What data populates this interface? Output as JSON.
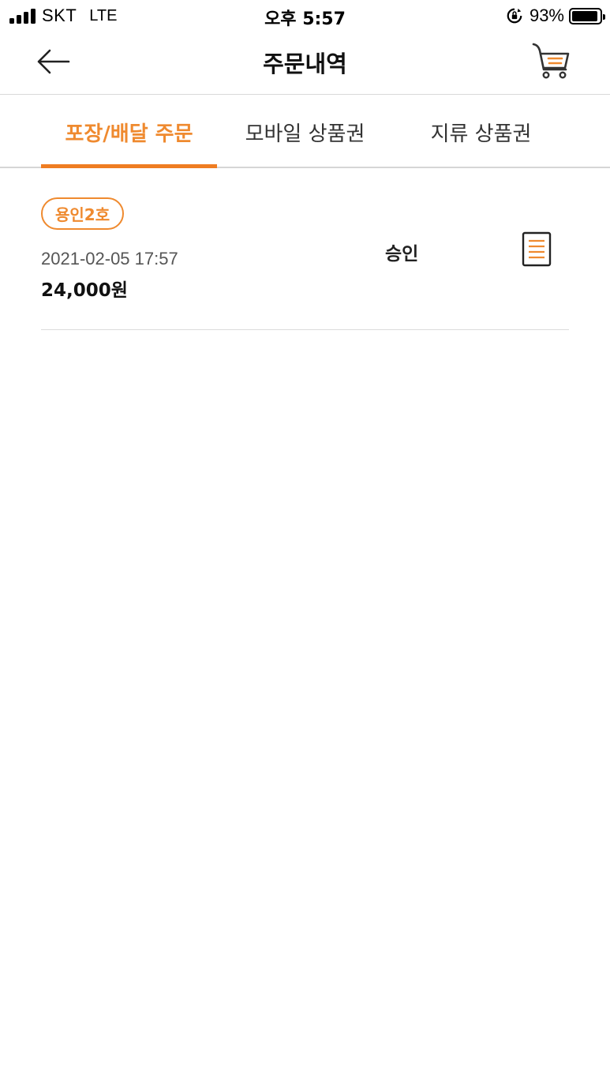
{
  "status_bar": {
    "carrier": "SKT",
    "network": "LTE",
    "time": "오후 5:57",
    "battery": "93%",
    "battery_level": 0.93
  },
  "header": {
    "title": "주문내역",
    "back_icon": "arrow-left-icon",
    "cart_icon": "cart-icon"
  },
  "tabs": [
    {
      "label": "포장/배달 주문",
      "active": true
    },
    {
      "label": "모바일 상품권",
      "active": false
    },
    {
      "label": "지류 상품권",
      "active": false
    }
  ],
  "orders": [
    {
      "store": "용인2호",
      "date": "2021-02-05 17:57",
      "amount": "24,000원",
      "status": "승인",
      "receipt_icon": "receipt-icon"
    }
  ],
  "colors": {
    "accent": "#ef8a2f",
    "indicator": "#ef7d22",
    "divider": "#d9d9d9"
  }
}
